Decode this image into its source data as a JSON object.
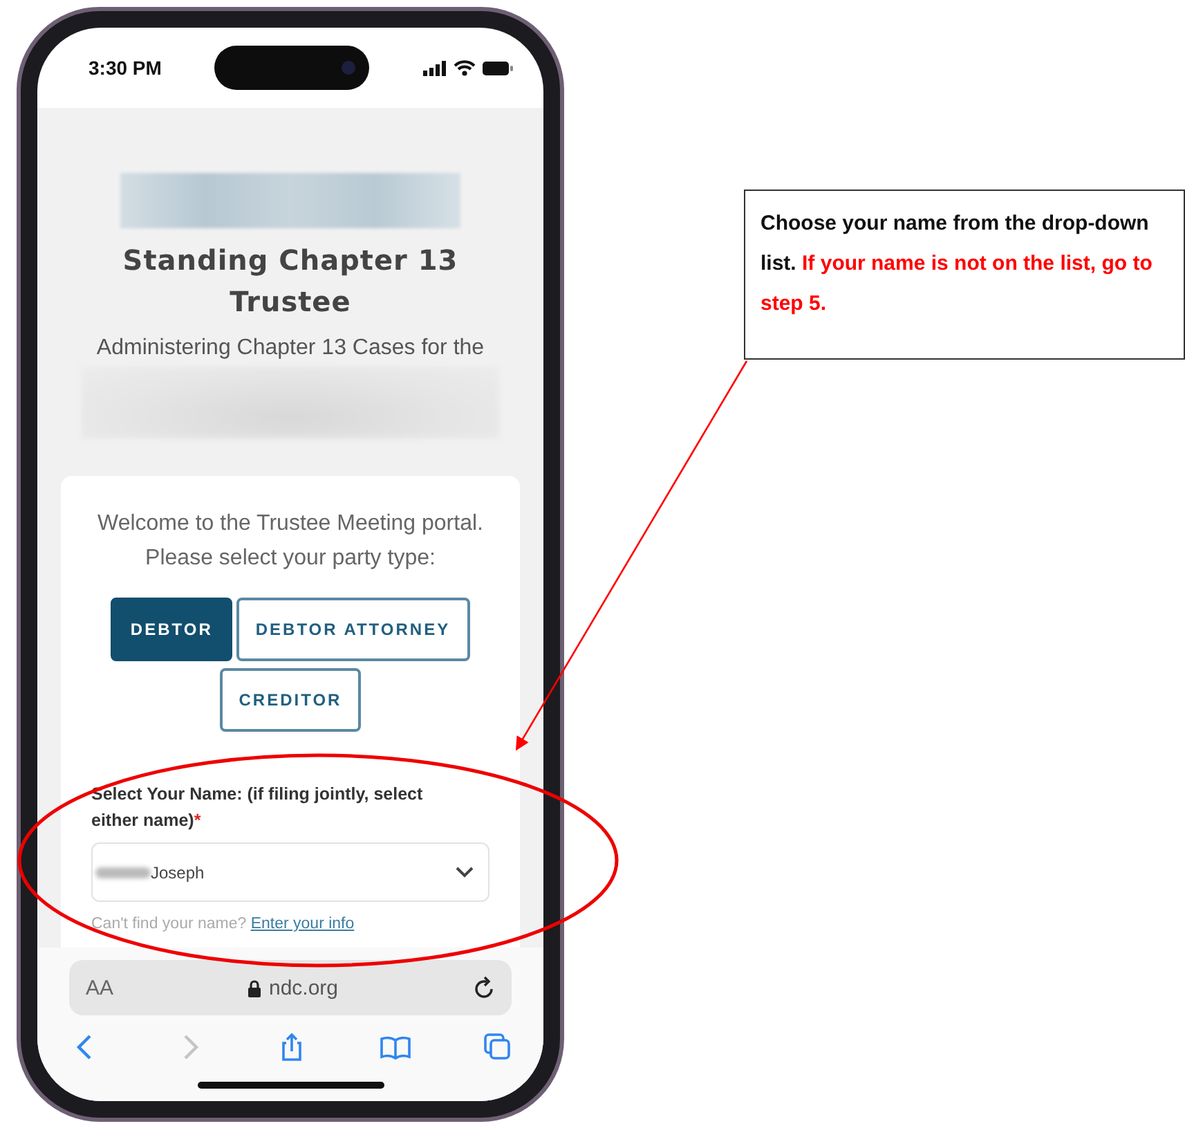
{
  "status_bar": {
    "time": "3:30 PM"
  },
  "header": {
    "title": "Standing Chapter 13 Trustee",
    "subtitle": "Administering Chapter 13 Cases for the"
  },
  "card": {
    "welcome": "Welcome to the Trustee Meeting portal. Please select your party type:",
    "party_types": [
      {
        "label": "DEBTOR",
        "selected": true
      },
      {
        "label": "DEBTOR ATTORNEY",
        "selected": false
      },
      {
        "label": "CREDITOR",
        "selected": false
      }
    ],
    "name_field": {
      "label": "Select Your Name: (if filing jointly, select either name)",
      "required_mark": "*",
      "value": "Joseph"
    },
    "help": {
      "text": "Can't find your name?",
      "link": "Enter your info"
    }
  },
  "browser": {
    "text_size": "AA",
    "url": "ndc.org",
    "toolbar": [
      {
        "kind": "back",
        "disabled": false
      },
      {
        "kind": "forward",
        "disabled": true
      },
      {
        "kind": "share",
        "disabled": false
      },
      {
        "kind": "bookmarks",
        "disabled": false
      },
      {
        "kind": "tabs",
        "disabled": false
      }
    ]
  },
  "callout": {
    "text": "Choose your name from the drop-down list.",
    "highlight": "If your name is not on the list, go to step 5."
  }
}
